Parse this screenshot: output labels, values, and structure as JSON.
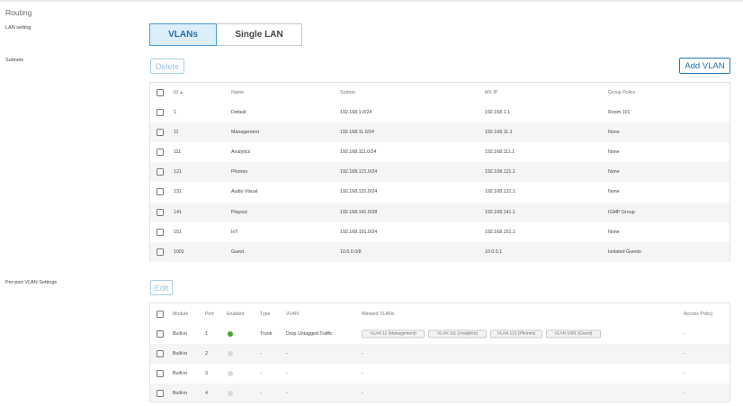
{
  "page": {
    "title": "Routing",
    "lan_setting_label": "LAN setting",
    "subnets_label": "Subnets",
    "per_port_label": "Per-port VLAN Settings"
  },
  "lan_toggle": {
    "options": [
      "VLANs",
      "Single LAN"
    ],
    "selected": "VLANs"
  },
  "subnets": {
    "delete_label": "Delete",
    "add_label": "Add VLAN",
    "headers": {
      "id": "ID",
      "sort_icon": "▲",
      "name": "Name",
      "subnet": "Subnet",
      "mx_ip": "MX IP",
      "group_policy": "Group Policy"
    },
    "rows": [
      {
        "id": "1",
        "name": "Default",
        "subnet": "192.168.1.0/24",
        "mx_ip": "192.168.1.1",
        "group_policy": "Room 101"
      },
      {
        "id": "11",
        "name": "Management",
        "subnet": "192.168.11.0/24",
        "mx_ip": "192.168.11.1",
        "group_policy": "None"
      },
      {
        "id": "111",
        "name": "Analytics",
        "subnet": "192.168.111.0/24",
        "mx_ip": "192.168.111.1",
        "group_policy": "None"
      },
      {
        "id": "121",
        "name": "Phones",
        "subnet": "192.168.121.0/24",
        "mx_ip": "192.168.121.1",
        "group_policy": "None"
      },
      {
        "id": "131",
        "name": "Audio Visual",
        "subnet": "192.168.131.0/24",
        "mx_ip": "192.168.131.1",
        "group_policy": "None"
      },
      {
        "id": "141",
        "name": "Playout",
        "subnet": "192.168.141.0/28",
        "mx_ip": "192.168.141.1",
        "group_policy": "IGMP Group"
      },
      {
        "id": "151",
        "name": "IoT",
        "subnet": "192.168.151.0/24",
        "mx_ip": "192.168.151.1",
        "group_policy": "None"
      },
      {
        "id": "1001",
        "name": "Guest",
        "subnet": "10.0.0.0/8",
        "mx_ip": "10.0.0.1",
        "group_policy": "Isolated Guests"
      }
    ]
  },
  "ports": {
    "edit_label": "Edit",
    "headers": {
      "module": "Module",
      "port": "Port",
      "enabled": "Enabled",
      "type": "Type",
      "vlan": "VLAN",
      "allowed": "Allowed VLANs",
      "access_policy": "Access Policy"
    },
    "rows": [
      {
        "module": "Built-in",
        "port": "1",
        "enabled": true,
        "type": "Trunk",
        "vlan": "Drop Untagged Traffic",
        "allowed": [
          "VLAN 11 (Management)",
          "VLAN 111 (Analytics)",
          "VLAN 121 (Phones)",
          "VLAN 1001 (Guest)"
        ],
        "access_policy": "-"
      },
      {
        "module": "Built-in",
        "port": "2",
        "enabled": false,
        "type": "-",
        "vlan": "-",
        "allowed_text": "-",
        "access_policy": "-"
      },
      {
        "module": "Built-in",
        "port": "3",
        "enabled": false,
        "type": "-",
        "vlan": "-",
        "allowed_text": "-",
        "access_policy": "-"
      },
      {
        "module": "Built-in",
        "port": "4",
        "enabled": false,
        "type": "-",
        "vlan": "-",
        "allowed_text": "-",
        "access_policy": "-"
      }
    ]
  },
  "colors": {
    "accent": "#1f6fb2",
    "enabled_dot": "#43a82d",
    "disabled_dot": "#dadada"
  }
}
